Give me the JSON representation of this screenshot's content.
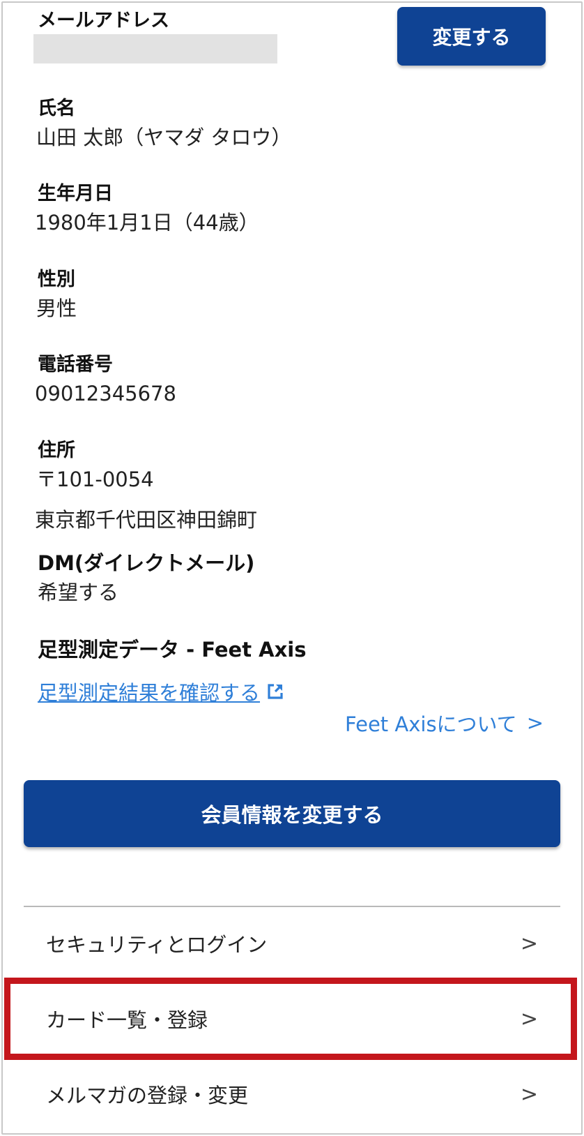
{
  "email": {
    "label": "メールアドレス",
    "change_button": "変更する"
  },
  "name": {
    "label": "氏名",
    "value": "山田 太郎（ヤマダ タロウ）"
  },
  "birthdate": {
    "label": "生年月日",
    "value": "1980年1月1日（44歳）"
  },
  "gender": {
    "label": "性別",
    "value": "男性"
  },
  "phone": {
    "label": "電話番号",
    "value": "09012345678"
  },
  "address": {
    "label": "住所",
    "postal": "〒101-0054",
    "line": "東京都千代田区神田錦町"
  },
  "dm": {
    "label": "DM(ダイレクトメール)",
    "value": "希望する"
  },
  "feet": {
    "label": "足型測定データ - Feet Axis",
    "result_link": "足型測定結果を確認する",
    "about_link": "Feet Axisについて",
    "about_chevron": ">"
  },
  "member_button": "会員情報を変更する",
  "menu": [
    {
      "label": "セキュリティとログイン",
      "chevron": ">"
    },
    {
      "label": "カード一覧・登録",
      "chevron": ">"
    },
    {
      "label": "メルマガの登録・変更",
      "chevron": ">"
    }
  ],
  "colors": {
    "primary": "#0f4394",
    "link": "#2f7fd8",
    "highlight": "#c4161c"
  },
  "icons": {
    "external_link": "external-link-icon",
    "chevron": "chevron-right-icon"
  }
}
